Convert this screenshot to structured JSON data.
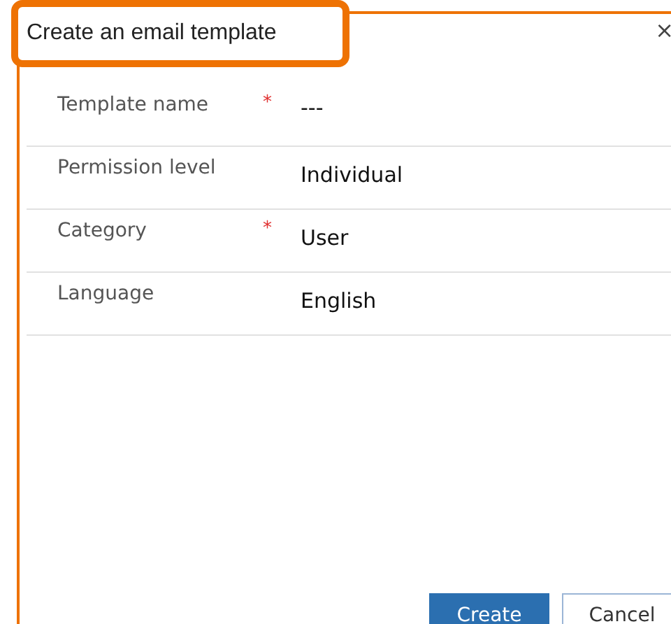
{
  "dialog": {
    "title": "Create an email template",
    "close": "×"
  },
  "fields": [
    {
      "label": "Template name",
      "required_mark": "*",
      "value": "---"
    },
    {
      "label": "Permission level",
      "value": "Individual"
    },
    {
      "label": "Category",
      "required_mark": "*",
      "value": "User"
    },
    {
      "label": "Language",
      "value": "English"
    }
  ],
  "buttons": [
    {
      "label": "Create",
      "kind": "primary"
    },
    {
      "label": "Cancel",
      "kind": "secondary"
    }
  ]
}
